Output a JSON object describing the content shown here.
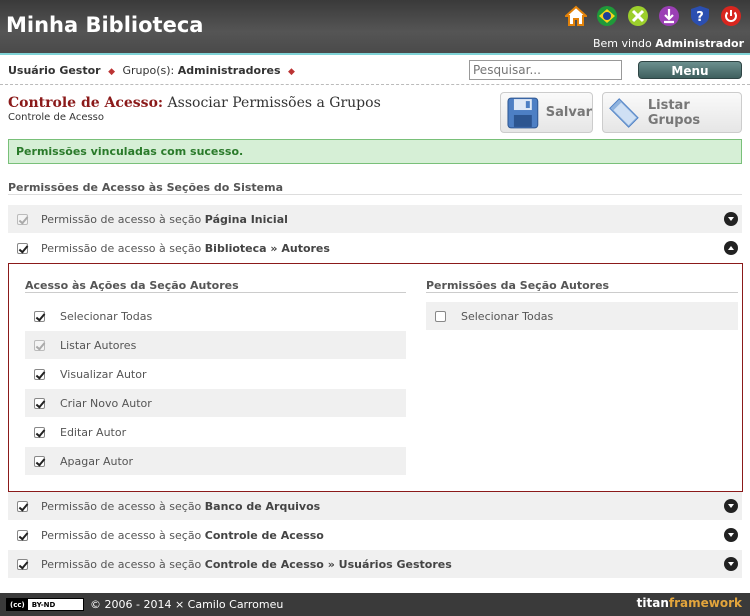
{
  "header": {
    "app_title": "Minha Biblioteca",
    "welcome_prefix": "Bem vindo",
    "welcome_user": "Administrador",
    "icons": [
      "home-icon",
      "language-flag-icon",
      "settings-icon",
      "download-icon",
      "help-icon",
      "power-icon"
    ]
  },
  "userbar": {
    "role_label": "Usuário Gestor",
    "groups_label": "Grupo(s):",
    "groups_value": "Administradores",
    "search_placeholder": "Pesquisar...",
    "menu_label": "Menu"
  },
  "page": {
    "title_prefix": "Controle de Acesso:",
    "title_rest": "Associar Permissões a Grupos",
    "subtitle": "Controle de Acesso",
    "save_label": "Salvar",
    "list_label": "Listar Grupos"
  },
  "message": "Permissões vinculadas com sucesso.",
  "section_title": "Permissões de Acesso às Seções do Sistema",
  "permission_prefix": "Permissão de acesso à seção",
  "sections": [
    {
      "name": "Página Inicial",
      "checked": true,
      "disabled": true
    },
    {
      "name": "Biblioteca » Autores",
      "checked": true,
      "disabled": false
    },
    {
      "name": "Banco de Arquivos",
      "checked": true,
      "disabled": false
    },
    {
      "name": "Controle de Acesso",
      "checked": true,
      "disabled": false
    },
    {
      "name": "Controle de Acesso » Usuários Gestores",
      "checked": true,
      "disabled": false
    }
  ],
  "actions": {
    "title": "Acesso às Ações da Seção Autores",
    "items": [
      {
        "label": "Selecionar Todas",
        "checked": true
      },
      {
        "label": "Listar Autores",
        "checked": true,
        "disabled": true
      },
      {
        "label": "Visualizar Autor",
        "checked": true
      },
      {
        "label": "Criar Novo Autor",
        "checked": true
      },
      {
        "label": "Editar Autor",
        "checked": true
      },
      {
        "label": "Apagar Autor",
        "checked": true
      }
    ]
  },
  "section_perms": {
    "title": "Permissões da Seção Autores",
    "items": [
      {
        "label": "Selecionar Todas",
        "checked": false
      }
    ]
  },
  "footer": {
    "license": "BY-ND",
    "copyright": "© 2006 - 2014 × Camilo Carromeu",
    "brand_a": "titan",
    "brand_b": "framework"
  }
}
